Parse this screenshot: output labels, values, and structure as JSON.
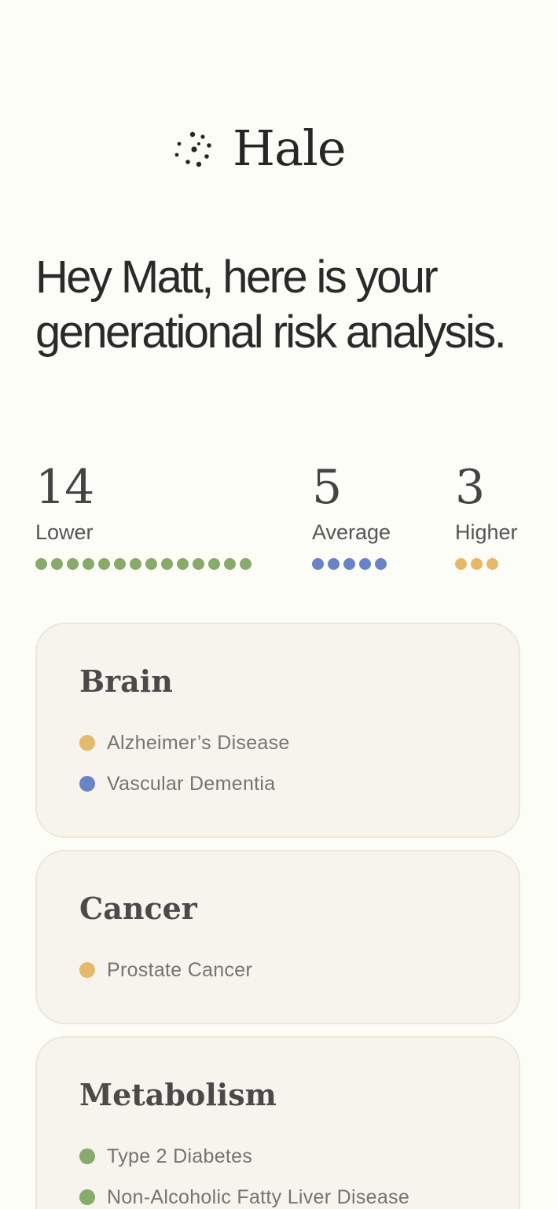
{
  "brand": {
    "name": "Hale",
    "icon": "dotted-circle-logo-icon"
  },
  "headline": "Hey Matt, here is your generational risk analysis.",
  "colors": {
    "lower": "#86ab6b",
    "average": "#6b82c6",
    "higher": "#e4b96a",
    "background": "#fdfdf8",
    "card_background": "#f6f4ec"
  },
  "summary": {
    "lower": {
      "count": "14",
      "label": "Lower",
      "dots": 14
    },
    "average": {
      "count": "5",
      "label": "Average",
      "dots": 5
    },
    "higher": {
      "count": "3",
      "label": "Higher",
      "dots": 3
    }
  },
  "categories": [
    {
      "title": "Brain",
      "items": [
        {
          "label": "Alzheimer’s Disease",
          "risk": "higher"
        },
        {
          "label": "Vascular Dementia",
          "risk": "average"
        }
      ]
    },
    {
      "title": "Cancer",
      "items": [
        {
          "label": "Prostate Cancer",
          "risk": "higher"
        }
      ]
    },
    {
      "title": "Metabolism",
      "items": [
        {
          "label": "Type 2 Diabetes",
          "risk": "lower"
        },
        {
          "label": "Non-Alcoholic Fatty Liver Disease",
          "risk": "lower"
        }
      ]
    }
  ]
}
